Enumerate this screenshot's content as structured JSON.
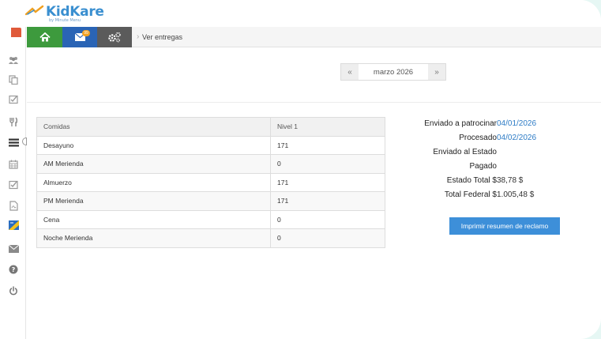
{
  "brand": {
    "name": "KidKare",
    "tagline": "by Minute Menu"
  },
  "nav": {
    "mail_badge": "99",
    "breadcrumb": "Ver entregas",
    "sidebar_icons": [
      "users-icon",
      "copy-icon",
      "checkbox-icon",
      "utensils-icon",
      "list-icon",
      "calendar-icon",
      "checkbox-icon",
      "pdf-icon",
      "claim-icon",
      "mail-icon",
      "help-icon",
      "power-icon"
    ]
  },
  "month_nav": {
    "prev": "«",
    "label": "marzo 2026",
    "next": "»"
  },
  "meals_table": {
    "headers": [
      "Comidas",
      "Nivel 1"
    ],
    "rows": [
      [
        "Desayuno",
        "171"
      ],
      [
        "AM Merienda",
        "0"
      ],
      [
        "Almuerzo",
        "171"
      ],
      [
        "PM Merienda",
        "171"
      ],
      [
        "Cena",
        "0"
      ],
      [
        "Noche Merienda",
        "0"
      ]
    ]
  },
  "summary": [
    {
      "label": "Enviado a patrocinar",
      "value": "04/01/2026",
      "link": true
    },
    {
      "label": "Procesado",
      "value": "04/02/2026",
      "link": true
    },
    {
      "label": "Enviado al Estado",
      "value": "",
      "link": false
    },
    {
      "label": "Pagado",
      "value": "",
      "link": false
    },
    {
      "label": "Estado Total $",
      "value": "38,78 $",
      "link": false
    },
    {
      "label": "Total Federal $",
      "value": "1.005,48 $",
      "link": false
    }
  ],
  "print_button": "Imprimir resumen de reclamo",
  "colors": {
    "home": "#3d9a3d",
    "mail": "#2a64b5",
    "settings": "#5b5b5b",
    "accent": "#3d8fd9",
    "link": "#2e7cc6"
  }
}
